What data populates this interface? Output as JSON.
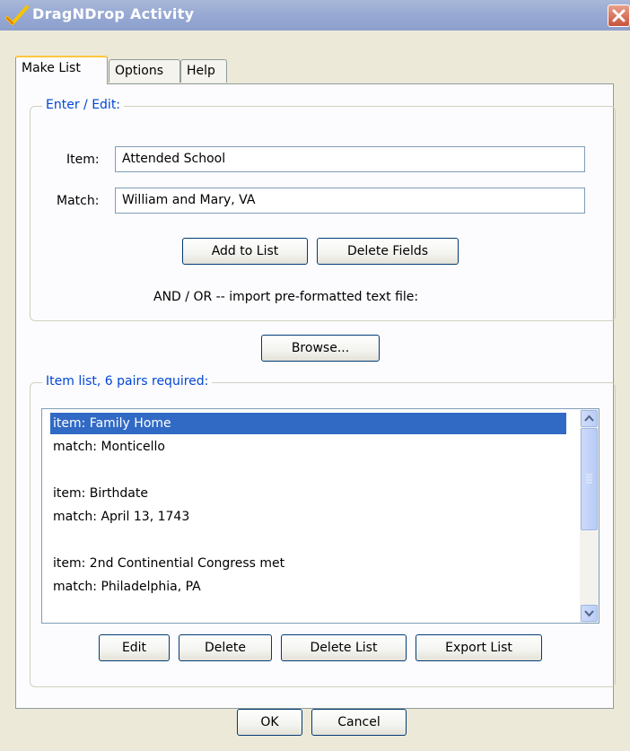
{
  "window": {
    "title": "DragNDrop Activity",
    "icon": "checkmark-icon"
  },
  "tabs": [
    {
      "label": "Make List",
      "active": true
    },
    {
      "label": "Options",
      "active": false
    },
    {
      "label": "Help",
      "active": false
    }
  ],
  "enter_edit": {
    "legend": "Enter / Edit:",
    "item_label": "Item:",
    "item_value": "Attended School",
    "match_label": "Match:",
    "match_value": "William and Mary, VA",
    "add_button": "Add to List",
    "delete_fields_button": "Delete Fields"
  },
  "import": {
    "text": "AND / OR -- import pre-formatted text file:",
    "browse_button": "Browse..."
  },
  "item_list": {
    "legend": "Item list, 6 pairs required:",
    "lines": [
      "item: Family Home",
      "match: Monticello",
      "",
      "item: Birthdate",
      "match: April 13, 1743",
      "",
      "item: 2nd Continential Congress met",
      "match: Philadelphia, PA"
    ],
    "selected_index": 0,
    "edit_button": "Edit",
    "delete_button": "Delete",
    "delete_list_button": "Delete List",
    "export_button": "Export List"
  },
  "footer": {
    "ok_button": "OK",
    "cancel_button": "Cancel"
  },
  "colors": {
    "accent": "#0046d5",
    "selection": "#316ac5",
    "titlebar": "#98aad4",
    "close": "#c8533a",
    "tab_highlight": "#ffc73c"
  }
}
